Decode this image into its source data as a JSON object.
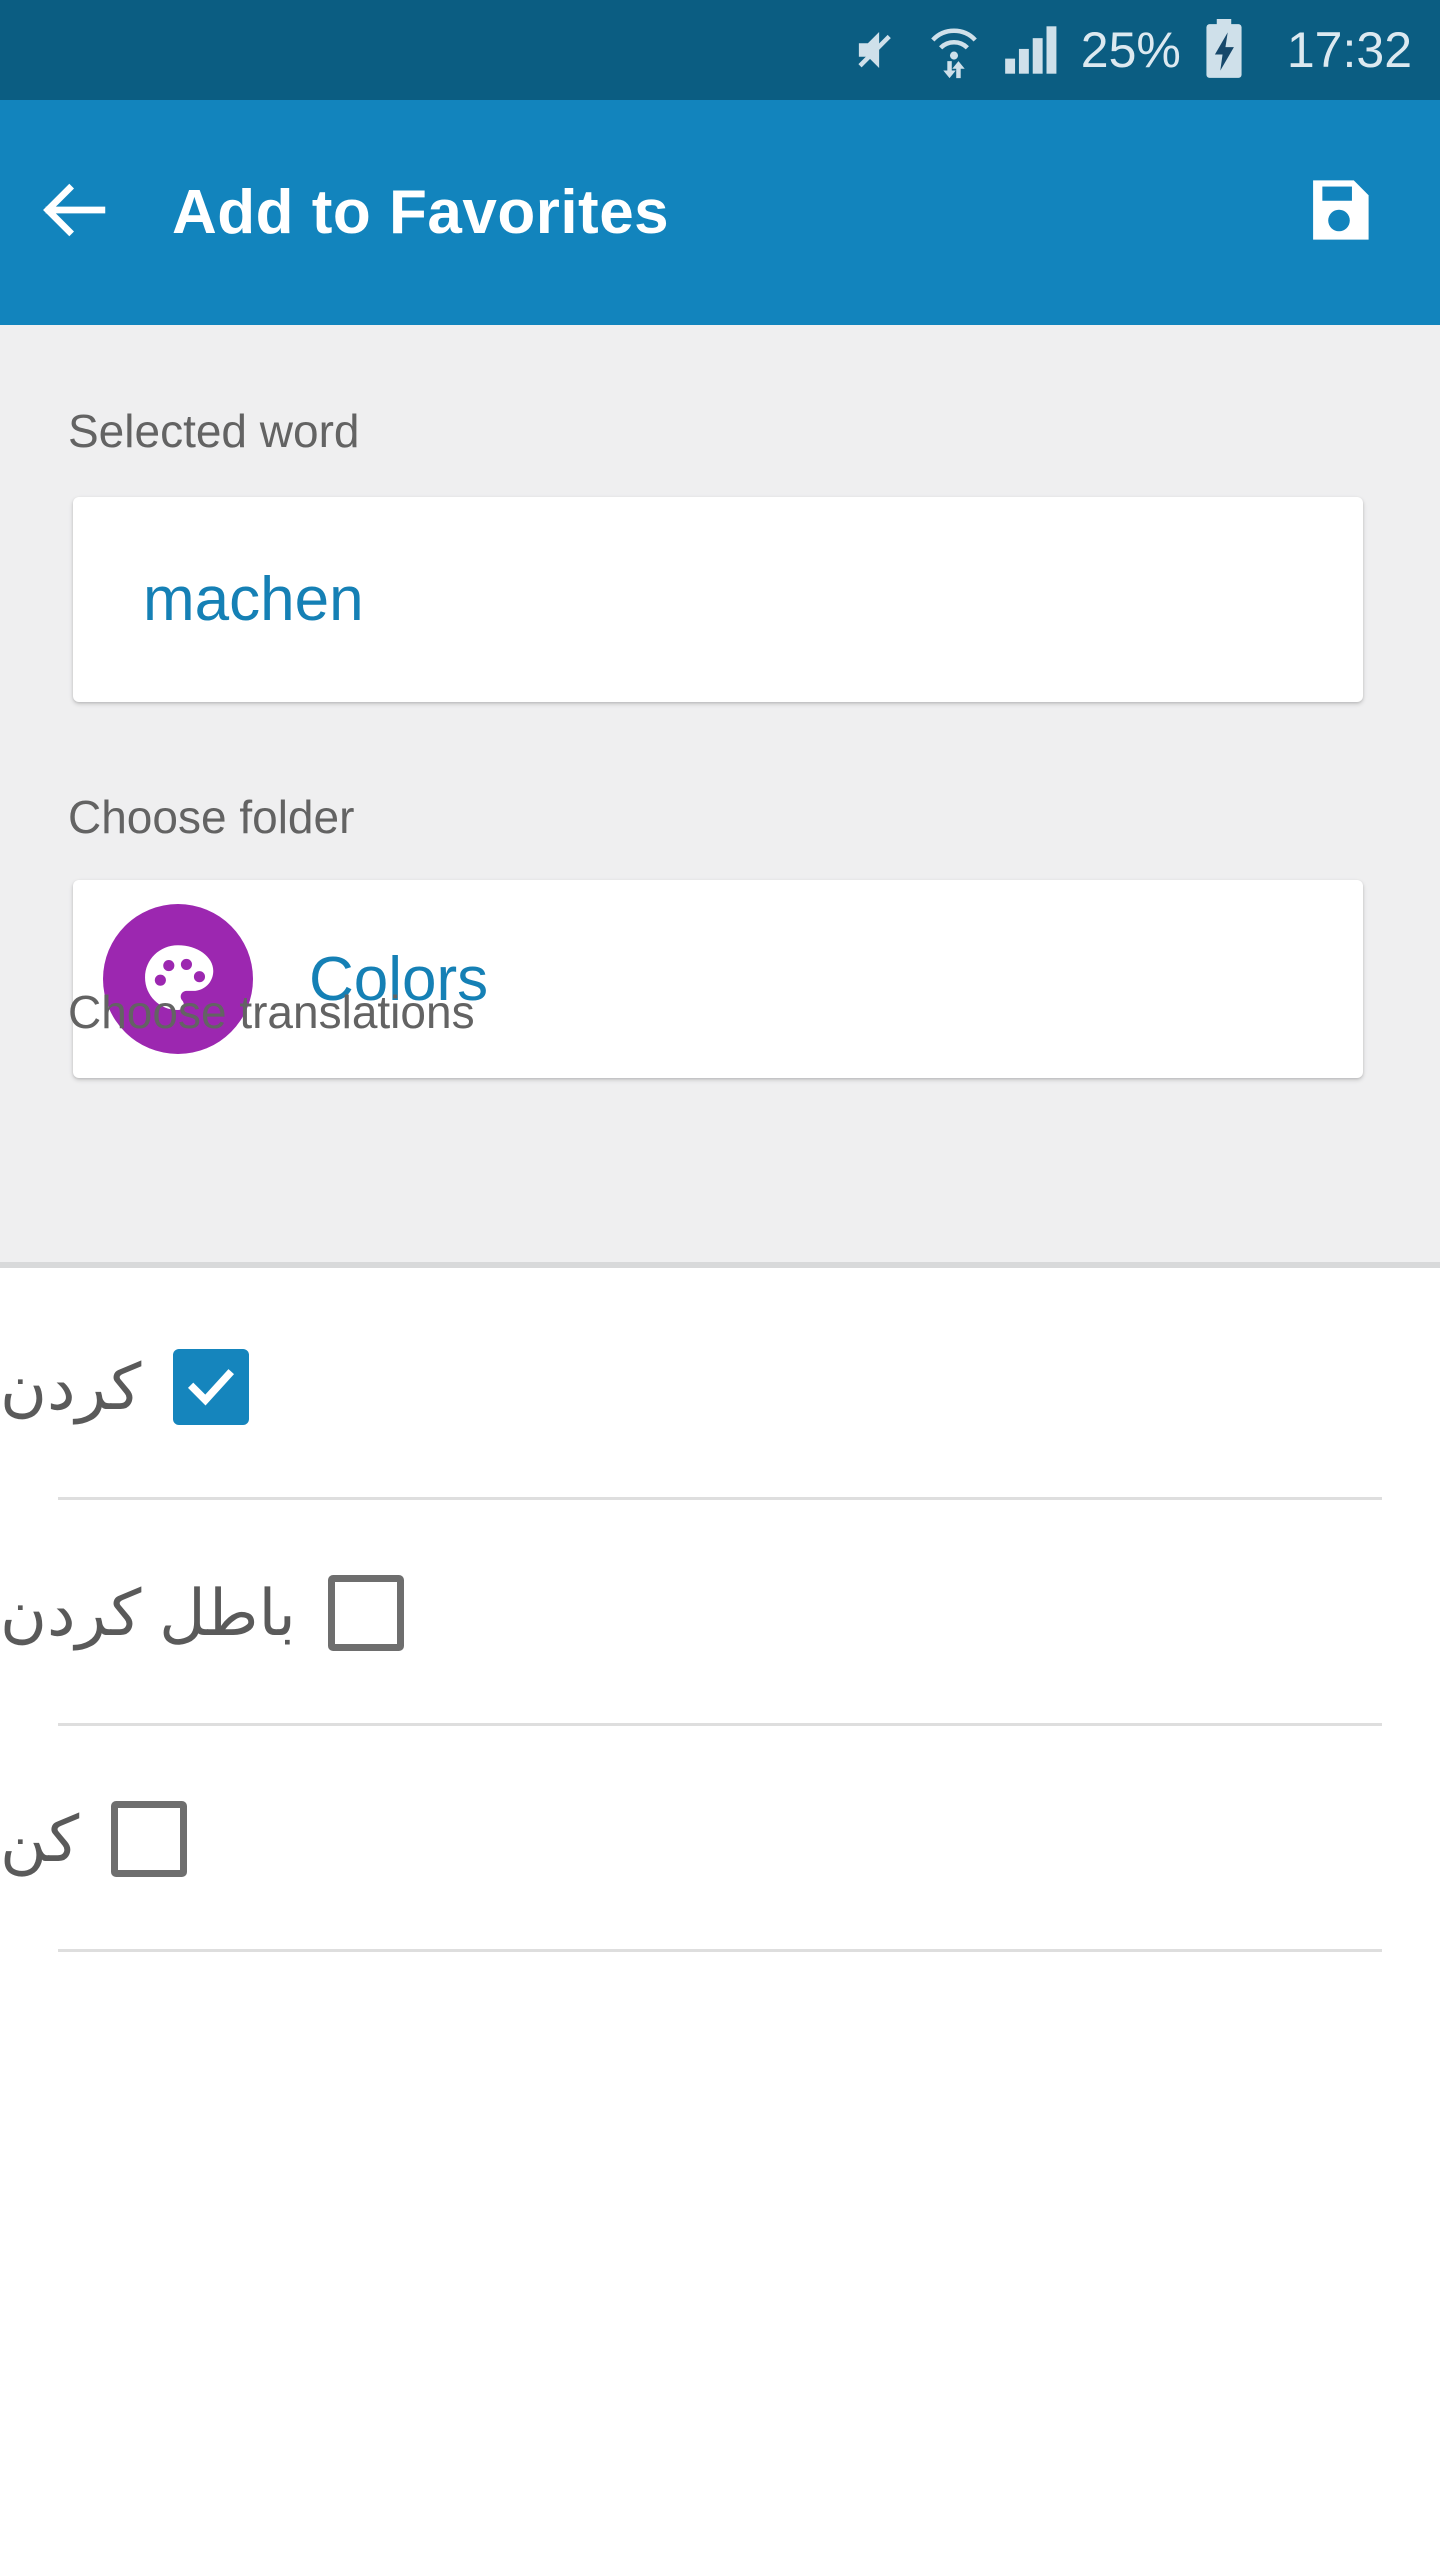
{
  "statusbar": {
    "icons": [
      "mute-icon",
      "wifi-transfer-icon",
      "cellular-signal-icon"
    ],
    "battery_percent": "25%",
    "battery_state": "charging",
    "clock": "17:32",
    "background": "#0b5d82",
    "foreground": "#dce9f0"
  },
  "appbar": {
    "back_icon": "back-arrow-icon",
    "title": "Add to Favorites",
    "save_icon": "save-floppy-icon",
    "background": "#1284bd",
    "foreground": "#ffffff"
  },
  "form": {
    "selected_word": {
      "label": "Selected word",
      "value": "machen"
    },
    "folder": {
      "label": "Choose folder",
      "name": "Colors",
      "icon": "palette-icon",
      "badge_color": "#9c27b0"
    },
    "translations": {
      "label": "Choose translations"
    },
    "accent_color": "#1580b5",
    "label_color": "#636363",
    "background": "#efeff0"
  },
  "translations": [
    {
      "text": "کردن",
      "checked": true
    },
    {
      "text": "باطل کردن",
      "checked": false
    },
    {
      "text": "کن",
      "checked": false
    }
  ]
}
